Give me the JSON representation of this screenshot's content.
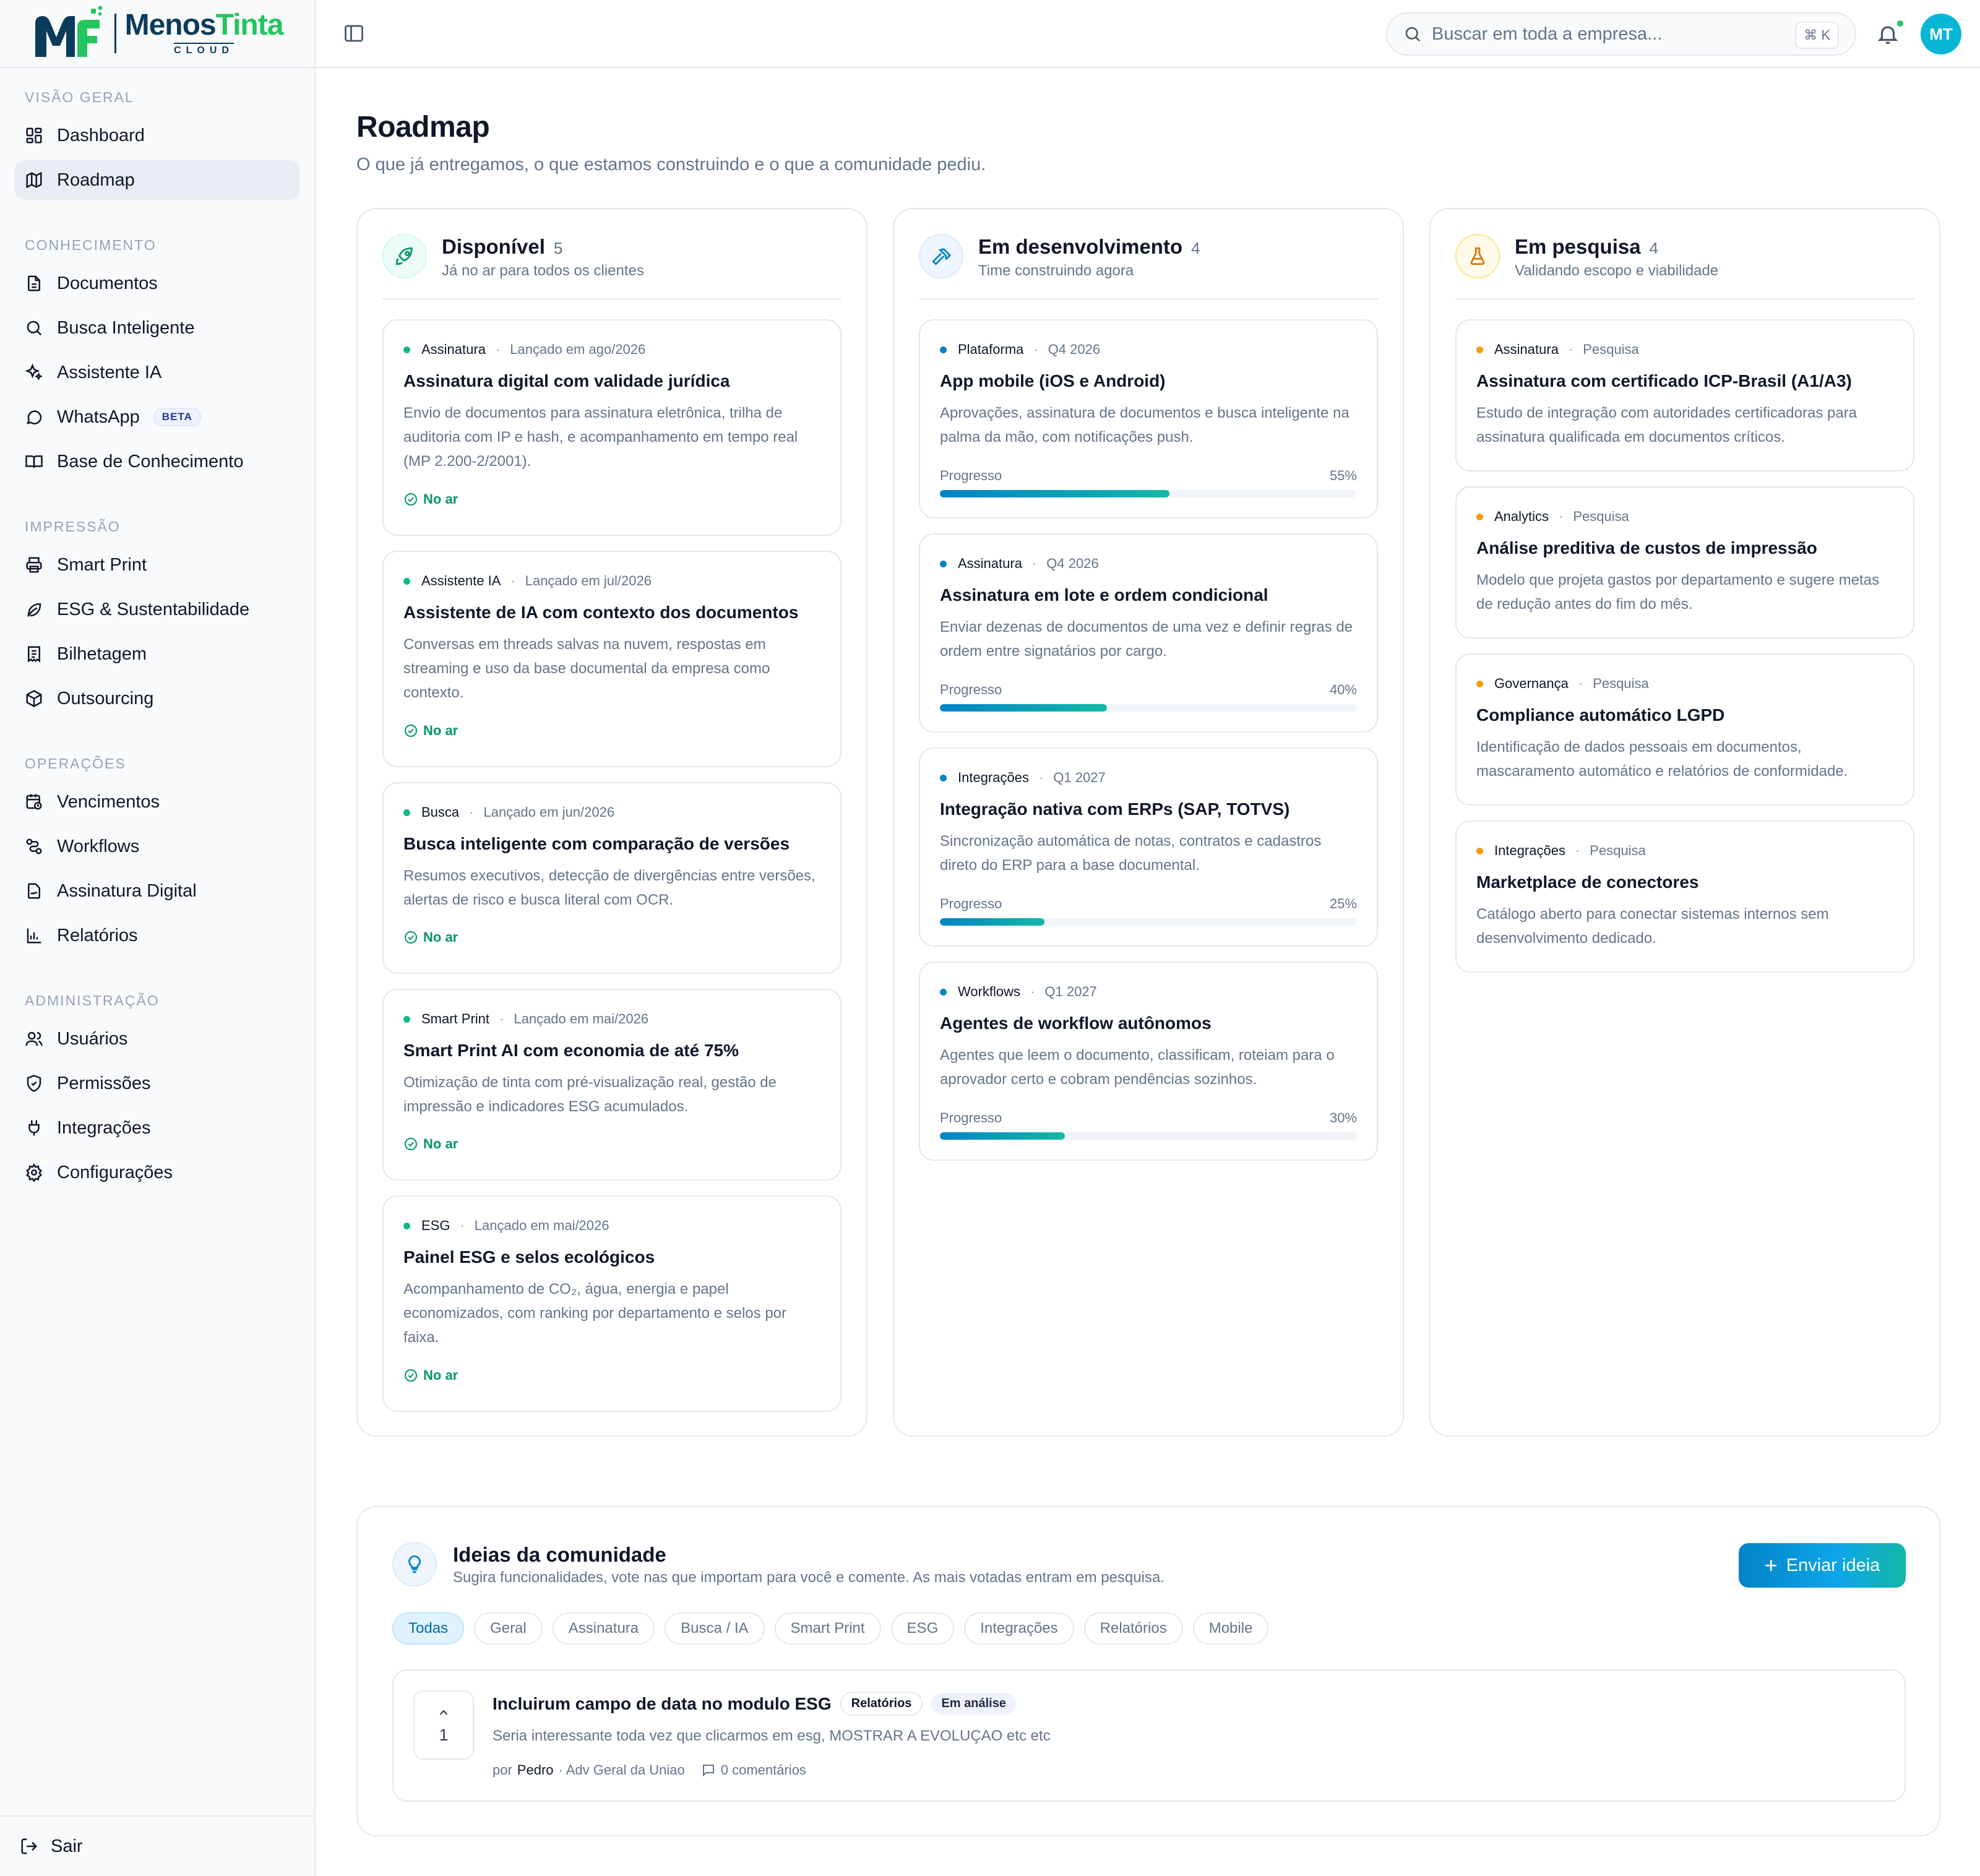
{
  "brand": {
    "name_part1": "Menos",
    "name_part2": "Tinta",
    "subtitle": "CLOUD",
    "colors": {
      "primary": "#0b3b5a",
      "green": "#22c55e",
      "accent": "#0284c7"
    }
  },
  "sidebar": {
    "sections": [
      {
        "title": "VISÃO GERAL",
        "items": [
          {
            "label": "Dashboard",
            "icon": "dashboard-icon"
          },
          {
            "label": "Roadmap",
            "icon": "map-icon",
            "active": true
          }
        ]
      },
      {
        "title": "CONHECIMENTO",
        "items": [
          {
            "label": "Documentos",
            "icon": "document-icon"
          },
          {
            "label": "Busca Inteligente",
            "icon": "search-icon"
          },
          {
            "label": "Assistente IA",
            "icon": "sparkles-icon"
          },
          {
            "label": "WhatsApp",
            "icon": "chat-icon",
            "badge": "BETA"
          },
          {
            "label": "Base de Conhecimento",
            "icon": "book-icon"
          }
        ]
      },
      {
        "title": "IMPRESSÃO",
        "items": [
          {
            "label": "Smart Print",
            "icon": "printer-icon"
          },
          {
            "label": "ESG & Sustentabilidade",
            "icon": "leaf-icon"
          },
          {
            "label": "Bilhetagem",
            "icon": "receipt-icon"
          },
          {
            "label": "Outsourcing",
            "icon": "package-icon"
          }
        ]
      },
      {
        "title": "OPERAÇÕES",
        "items": [
          {
            "label": "Vencimentos",
            "icon": "calendar-clock-icon"
          },
          {
            "label": "Workflows",
            "icon": "workflow-icon"
          },
          {
            "label": "Assinatura Digital",
            "icon": "signature-icon"
          },
          {
            "label": "Relatórios",
            "icon": "bar-chart-icon"
          }
        ]
      },
      {
        "title": "ADMINISTRAÇÃO",
        "items": [
          {
            "label": "Usuários",
            "icon": "users-icon"
          },
          {
            "label": "Permissões",
            "icon": "shield-icon"
          },
          {
            "label": "Integrações",
            "icon": "plug-icon"
          },
          {
            "label": "Configurações",
            "icon": "gear-icon"
          }
        ]
      }
    ],
    "logout": "Sair"
  },
  "topbar": {
    "search_placeholder": "Buscar em toda a empresa...",
    "shortcut": "⌘ K",
    "avatar_initials": "MT"
  },
  "page": {
    "title": "Roadmap",
    "subtitle": "O que já entregamos, o que estamos construindo e o que a comunidade pediu."
  },
  "columns": [
    {
      "title": "Disponível",
      "count": "5",
      "subtitle": "Já no ar para todos os clientes",
      "icon": "rocket-icon",
      "color": "#10b981",
      "cards": [
        {
          "category": "Assinatura",
          "when": "Lançado em ago/2026",
          "title": "Assinatura digital com validade jurídica",
          "desc": "Envio de documentos para assinatura eletrônica, trilha de auditoria com IP e hash, e acompanhamento em tempo real (MP 2.200-2/2001).",
          "status": "No ar"
        },
        {
          "category": "Assistente IA",
          "when": "Lançado em jul/2026",
          "title": "Assistente de IA com contexto dos documentos",
          "desc": "Conversas em threads salvas na nuvem, respostas em streaming e uso da base documental da empresa como contexto.",
          "status": "No ar"
        },
        {
          "category": "Busca",
          "when": "Lançado em jun/2026",
          "title": "Busca inteligente com comparação de versões",
          "desc": "Resumos executivos, detecção de divergências entre versões, alertas de risco e busca literal com OCR.",
          "status": "No ar"
        },
        {
          "category": "Smart Print",
          "when": "Lançado em mai/2026",
          "title": "Smart Print AI com economia de até 75%",
          "desc": "Otimização de tinta com pré-visualização real, gestão de impressão e indicadores ESG acumulados.",
          "status": "No ar"
        },
        {
          "category": "ESG",
          "when": "Lançado em mai/2026",
          "title": "Painel ESG e selos ecológicos",
          "desc": "Acompanhamento de CO₂, água, energia e papel economizados, com ranking por departamento e selos por faixa.",
          "status": "No ar"
        }
      ]
    },
    {
      "title": "Em desenvolvimento",
      "count": "4",
      "subtitle": "Time construindo agora",
      "icon": "hammer-icon",
      "color": "#0284c7",
      "cards": [
        {
          "category": "Plataforma",
          "when": "Q4 2026",
          "title": "App mobile (iOS e Android)",
          "desc": "Aprovações, assinatura de documentos e busca inteligente na palma da mão, com notificações push.",
          "progress_label": "Progresso",
          "progress": 55,
          "progress_text": "55%"
        },
        {
          "category": "Assinatura",
          "when": "Q4 2026",
          "title": "Assinatura em lote e ordem condicional",
          "desc": "Enviar dezenas de documentos de uma vez e definir regras de ordem entre signatários por cargo.",
          "progress_label": "Progresso",
          "progress": 40,
          "progress_text": "40%"
        },
        {
          "category": "Integrações",
          "when": "Q1 2027",
          "title": "Integração nativa com ERPs (SAP, TOTVS)",
          "desc": "Sincronização automática de notas, contratos e cadastros direto do ERP para a base documental.",
          "progress_label": "Progresso",
          "progress": 25,
          "progress_text": "25%"
        },
        {
          "category": "Workflows",
          "when": "Q1 2027",
          "title": "Agentes de workflow autônomos",
          "desc": "Agentes que leem o documento, classificam, roteiam para o aprovador certo e cobram pendências sozinhos.",
          "progress_label": "Progresso",
          "progress": 30,
          "progress_text": "30%"
        }
      ]
    },
    {
      "title": "Em pesquisa",
      "count": "4",
      "subtitle": "Validando escopo e viabilidade",
      "icon": "flask-icon",
      "color": "#f59e0b",
      "cards": [
        {
          "category": "Assinatura",
          "when": "Pesquisa",
          "title": "Assinatura com certificado ICP-Brasil (A1/A3)",
          "desc": "Estudo de integração com autoridades certificadoras para assinatura qualificada em documentos críticos."
        },
        {
          "category": "Analytics",
          "when": "Pesquisa",
          "title": "Análise preditiva de custos de impressão",
          "desc": "Modelo que projeta gastos por departamento e sugere metas de redução antes do fim do mês."
        },
        {
          "category": "Governança",
          "when": "Pesquisa",
          "title": "Compliance automático LGPD",
          "desc": "Identificação de dados pessoais em documentos, mascaramento automático e relatórios de conformidade."
        },
        {
          "category": "Integrações",
          "when": "Pesquisa",
          "title": "Marketplace de conectores",
          "desc": "Catálogo aberto para conectar sistemas internos sem desenvolvimento dedicado."
        }
      ]
    }
  ],
  "ideas": {
    "title": "Ideias da comunidade",
    "subtitle": "Sugira funcionalidades, vote nas que importam para você e comente. As mais votadas entram em pesquisa.",
    "button": "Enviar ideia",
    "filters": [
      "Todas",
      "Geral",
      "Assinatura",
      "Busca / IA",
      "Smart Print",
      "ESG",
      "Integrações",
      "Relatórios",
      "Mobile"
    ],
    "active_filter": "Todas",
    "items": [
      {
        "votes": "1",
        "title": "Incluirum campo de data no modulo ESG",
        "category": "Relatórios",
        "status": "Em análise",
        "desc": "Seria interessante toda vez que clicarmos em esg, MOSTRAR A EVOLUÇAO etc etc",
        "by": "por",
        "author": "Pedro",
        "org": "· Adv Geral da Uniao",
        "comments": "0 comentários"
      }
    ]
  }
}
